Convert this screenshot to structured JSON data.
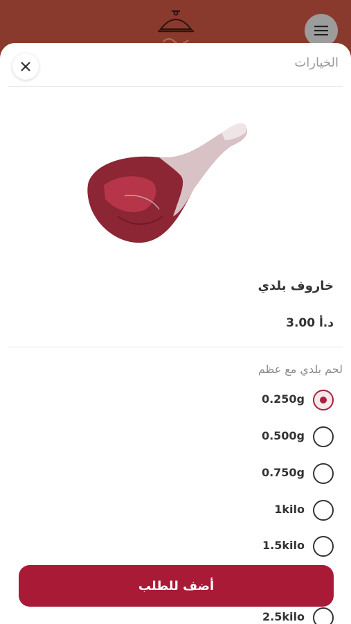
{
  "header": {
    "logo_icon": "restaurant-cloche-logo",
    "menu_icon": "hamburger-menu-icon"
  },
  "sheet": {
    "title": "الخيارات",
    "close_icon": "close-icon"
  },
  "product": {
    "image_icon": "lamb-leg-image",
    "name": "خاروف بلدي",
    "price": "3.00 د.أ"
  },
  "options": {
    "group_label": "لحم بلدي مع عظم",
    "items": [
      {
        "label": "0.250g",
        "selected": true
      },
      {
        "label": "0.500g",
        "selected": false
      },
      {
        "label": "0.750g",
        "selected": false
      },
      {
        "label": "1kilo",
        "selected": false
      },
      {
        "label": "1.5kilo",
        "selected": false
      },
      {
        "label": "2.5kilo",
        "selected": false
      }
    ]
  },
  "actions": {
    "add_to_order": "أضف للطلب"
  },
  "colors": {
    "accent": "#a81a36",
    "header_bg": "#8a3a2c"
  }
}
